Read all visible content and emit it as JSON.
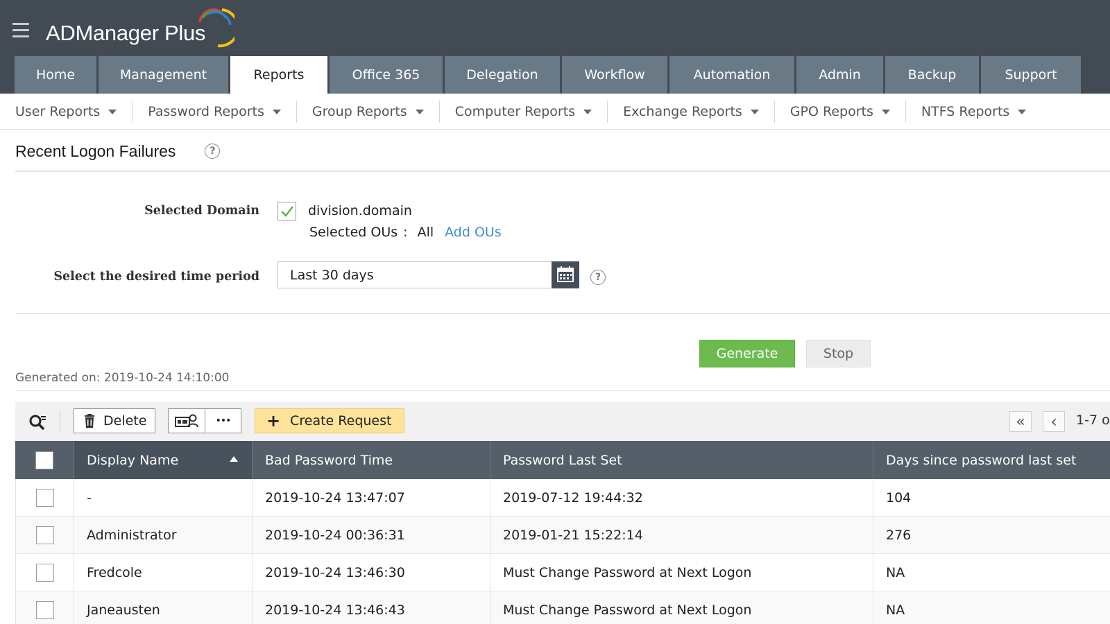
{
  "header": {
    "brand": "ADManager Plus",
    "main_tabs": [
      {
        "label": "Home"
      },
      {
        "label": "Management"
      },
      {
        "label": "Reports",
        "active": true
      },
      {
        "label": "Office 365"
      },
      {
        "label": "Delegation"
      },
      {
        "label": "Workflow"
      },
      {
        "label": "Automation"
      },
      {
        "label": "Admin"
      },
      {
        "label": "Backup"
      },
      {
        "label": "Support"
      }
    ]
  },
  "sub_nav": {
    "items": [
      {
        "label": "User Reports"
      },
      {
        "label": "Password Reports"
      },
      {
        "label": "Group Reports"
      },
      {
        "label": "Computer Reports"
      },
      {
        "label": "Exchange Reports"
      },
      {
        "label": "GPO Reports"
      },
      {
        "label": "NTFS Reports"
      }
    ]
  },
  "page": {
    "title": "Recent Logon Failures",
    "help_glyph": "?"
  },
  "form": {
    "domain_label": "Selected Domain",
    "domain_value": "division.domain",
    "domain_checked": true,
    "ous_label": "Selected OUs",
    "ous_separator": ":",
    "ous_value": "All",
    "add_ous_link": "Add OUs",
    "period_label": "Select the desired time period",
    "period_value": "Last 30 days",
    "generate_label": "Generate",
    "stop_label": "Stop",
    "generated_on": "Generated on: 2019-10-24 14:10:00"
  },
  "toolbar": {
    "delete_label": "Delete",
    "more_label": "•••",
    "create_request_label": "Create Request",
    "create_request_plus": "+",
    "first_page_glyph": "«",
    "prev_page_glyph": "‹",
    "page_range": "1-7 o"
  },
  "table": {
    "columns": [
      "Display Name",
      "Bad Password Time",
      "Password Last Set",
      "Days since password last set"
    ],
    "sort_column": "Display Name",
    "rows": [
      {
        "display_name": "-",
        "bad_password_time": "2019-10-24 13:47:07",
        "password_last_set": "2019-07-12 19:44:32",
        "days": "104"
      },
      {
        "display_name": "Administrator",
        "bad_password_time": "2019-10-24 00:36:31",
        "password_last_set": "2019-01-21 15:22:14",
        "days": "276"
      },
      {
        "display_name": "Fredcole",
        "bad_password_time": "2019-10-24 13:46:30",
        "password_last_set": "Must Change Password at Next Logon",
        "days": "NA"
      },
      {
        "display_name": "Janeausten",
        "bad_password_time": "2019-10-24 13:46:43",
        "password_last_set": "Must Change Password at Next Logon",
        "days": "NA"
      }
    ]
  },
  "colors": {
    "topbar": "#424b54",
    "tab": "#6a7986",
    "generate": "#6dbb4f",
    "create_request": "#ffe39a",
    "link": "#3d8fd1",
    "table_header": "#545f69"
  },
  "icons": {
    "menu": "hamburger-menu-icon",
    "logo": "admanager-arc-logo-icon",
    "help": "question-circle-icon",
    "calendar": "calendar-icon",
    "check": "checkmark-icon",
    "search": "search-filter-icon",
    "delete": "trash-icon",
    "view": "user-card-icon",
    "sort": "sort-ascending-icon"
  }
}
